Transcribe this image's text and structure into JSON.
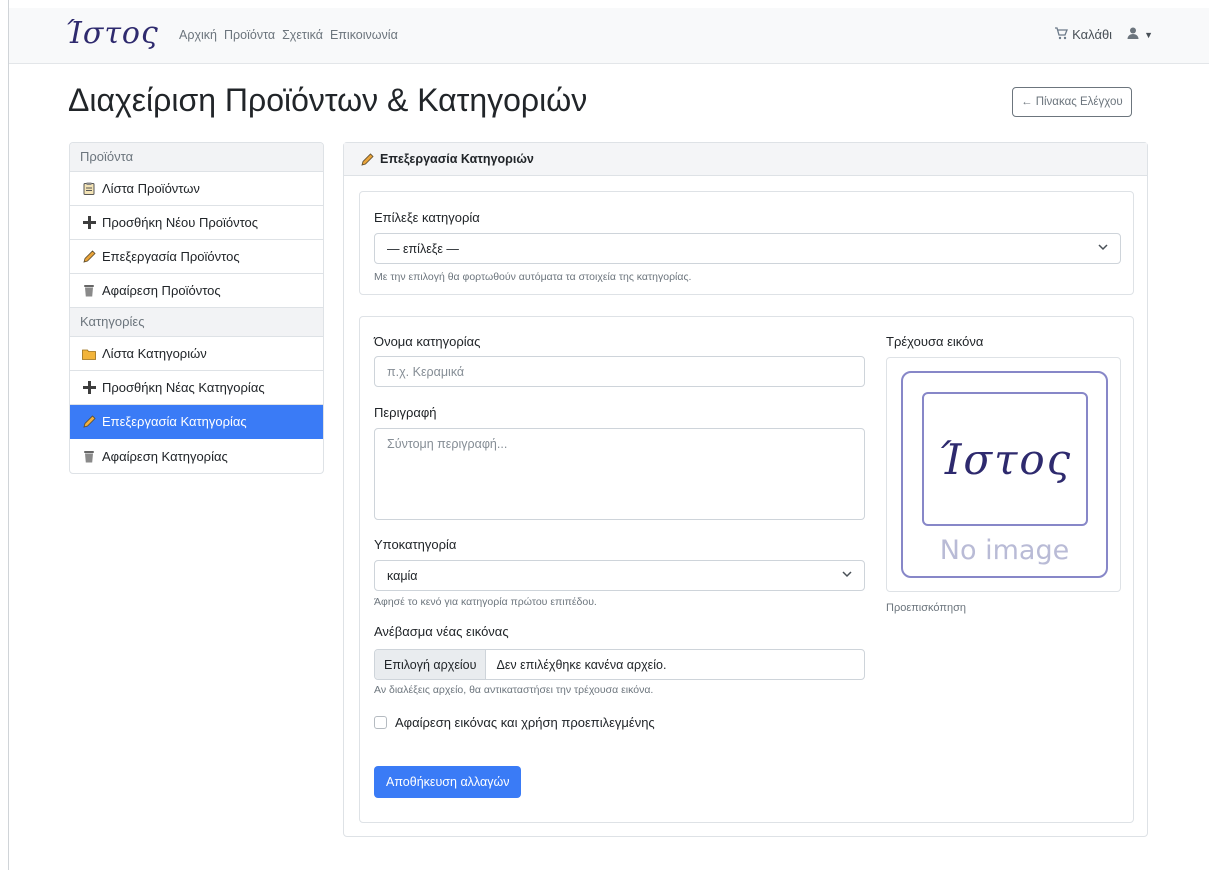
{
  "nav": {
    "brand": "Ίστος",
    "links": [
      "Αρχική",
      "Προϊόντα",
      "Σχετικά",
      "Επικοινωνία"
    ],
    "cart_label": "Καλάθι"
  },
  "header": {
    "title": "Διαχείριση Προϊόντων & Κατηγοριών",
    "dashboard_button": "← Πίνακας Ελέγχου"
  },
  "sidebar": {
    "products_heading": "Προϊόντα",
    "product_items": [
      {
        "label": "Λίστα Προϊόντων",
        "icon": "clipboard-icon"
      },
      {
        "label": "Προσθήκη Νέου Προϊόντος",
        "icon": "plus-icon"
      },
      {
        "label": "Επεξεργασία Προϊόντος",
        "icon": "pencil-icon"
      },
      {
        "label": "Αφαίρεση Προϊόντος",
        "icon": "trash-icon"
      }
    ],
    "categories_heading": "Κατηγορίες",
    "category_items": [
      {
        "label": "Λίστα Κατηγοριών",
        "icon": "folder-icon"
      },
      {
        "label": "Προσθήκη Νέας Κατηγορίας",
        "icon": "plus-icon"
      },
      {
        "label": "Επεξεργασία Κατηγορίας",
        "icon": "pencil-icon",
        "active": true
      },
      {
        "label": "Αφαίρεση Κατηγορίας",
        "icon": "trash-icon"
      }
    ]
  },
  "card": {
    "title": "Επεξεργασία Κατηγοριών",
    "select_category": {
      "label": "Επίλεξε κατηγορία",
      "value": "— επίλεξε —",
      "help": "Με την επιλογή θα φορτωθούν αυτόματα τα στοιχεία της κατηγορίας."
    },
    "name": {
      "label": "Όνομα κατηγορίας",
      "placeholder": "π.χ. Κεραμικά"
    },
    "description": {
      "label": "Περιγραφή",
      "placeholder": "Σύντομη περιγραφή..."
    },
    "subcategory": {
      "label": "Υποκατηγορία",
      "value": "καμία",
      "help": "Άφησέ το κενό για κατηγορία πρώτου επιπέδου."
    },
    "upload": {
      "label": "Ανέβασμα νέας εικόνας",
      "button": "Επιλογή αρχείου",
      "filename": "Δεν επιλέχθηκε κανένα αρχείο.",
      "help": "Αν διαλέξεις αρχείο, θα αντικαταστήσει την τρέχουσα εικόνα."
    },
    "remove_image_checkbox": "Αφαίρεση εικόνας και χρήση προεπιλεγμένης",
    "save_button": "Αποθήκευση αλλαγών",
    "current_image": {
      "label": "Τρέχουσα εικόνα",
      "logo_text": "Ίστος",
      "placeholder_text": "No image",
      "caption": "Προεπισκόπηση"
    }
  },
  "colors": {
    "primary": "#3a7bf6",
    "brand": "#2e2a6e"
  }
}
